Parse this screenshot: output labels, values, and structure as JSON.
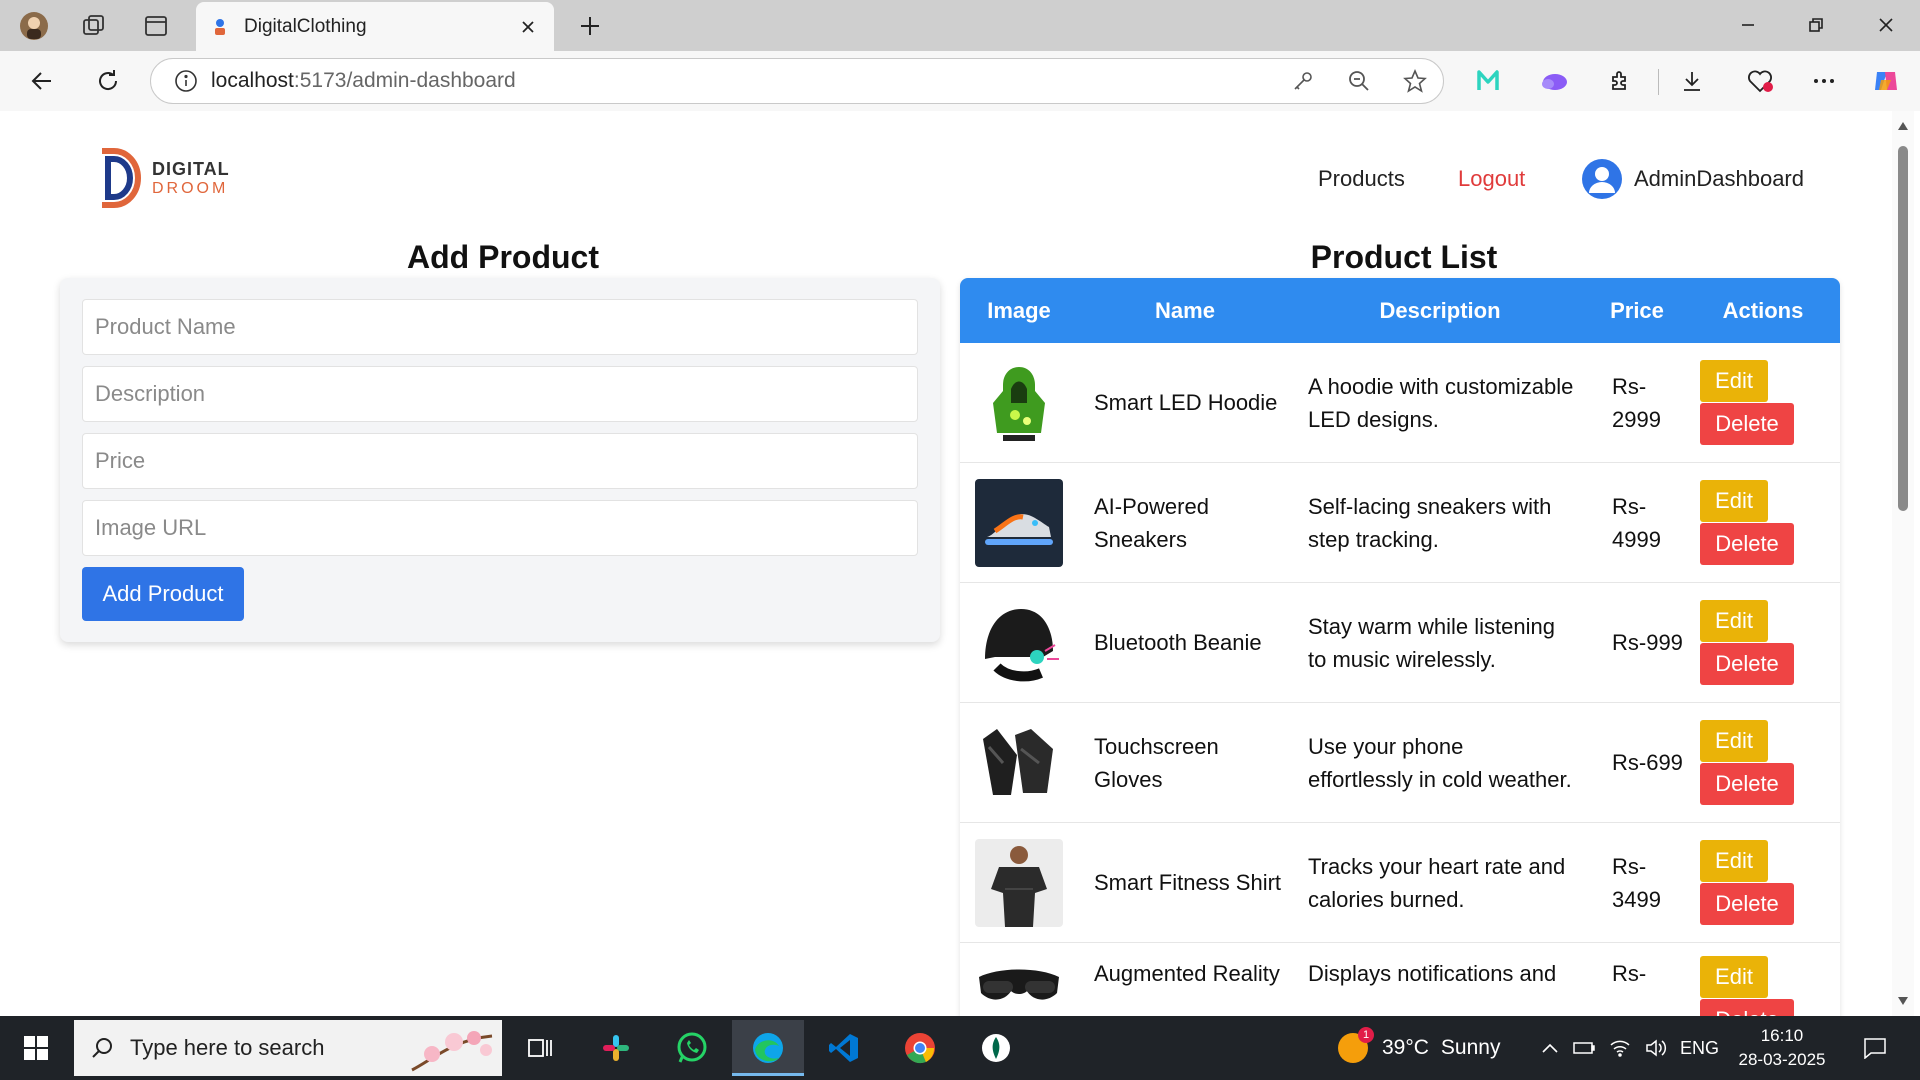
{
  "browser": {
    "tab_title": "DigitalClothing",
    "url_host": "localhost",
    "url_rest": ":5173/admin-dashboard"
  },
  "header": {
    "logo_line1": "DIGITAL",
    "logo_line2": "DROOM",
    "nav_products": "Products",
    "nav_logout": "Logout",
    "nav_admin": "AdminDashboard"
  },
  "add_product": {
    "title": "Add Product",
    "name_placeholder": "Product Name",
    "description_placeholder": "Description",
    "price_placeholder": "Price",
    "image_placeholder": "Image URL",
    "submit_label": "Add Product"
  },
  "product_list": {
    "title": "Product List",
    "columns": [
      "Image",
      "Name",
      "Description",
      "Price",
      "Actions"
    ],
    "edit_label": "Edit",
    "delete_label": "Delete",
    "rows": [
      {
        "name": "Smart LED Hoodie",
        "description": "A hoodie with customizable LED designs.",
        "price": "Rs-2999"
      },
      {
        "name": "AI-Powered Sneakers",
        "description": "Self-lacing sneakers with step tracking.",
        "price": "Rs-4999"
      },
      {
        "name": "Bluetooth Beanie",
        "description": "Stay warm while listening to music wirelessly.",
        "price": "Rs-999"
      },
      {
        "name": "Touchscreen Gloves",
        "description": "Use your phone effortlessly in cold weather.",
        "price": "Rs-699"
      },
      {
        "name": "Smart Fitness Shirt",
        "description": "Tracks your heart rate and calories burned.",
        "price": "Rs-3499"
      },
      {
        "name": "Augmented Reality",
        "description": "Displays notifications and",
        "price": "Rs-"
      }
    ]
  },
  "taskbar": {
    "search_placeholder": "Type here to search",
    "weather_temp": "39°C",
    "weather_desc": "Sunny",
    "weather_badge": "1",
    "language": "ENG",
    "time": "16:10",
    "date": "28-03-2025"
  },
  "colors": {
    "primary": "#2f74e6",
    "table_header": "#2f8bef",
    "edit": "#eab308",
    "delete": "#ef4444",
    "logout": "#e03b3b"
  }
}
